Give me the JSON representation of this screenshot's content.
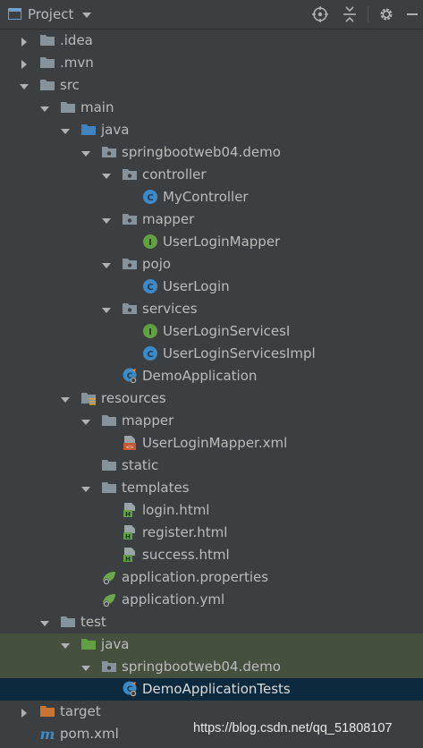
{
  "header": {
    "title": "Project"
  },
  "tree": [
    {
      "label": "target",
      "depth": 0,
      "arrow": "right",
      "icon": "folder-orange",
      "name": "tree-item-target",
      "top": 0
    },
    {
      "label": ".idea",
      "depth": 0,
      "arrow": "right",
      "icon": "folder"
    },
    {
      "label": ".mvn",
      "depth": 0,
      "arrow": "right",
      "icon": "folder"
    },
    {
      "label": "src",
      "depth": 0,
      "arrow": "down",
      "icon": "folder"
    },
    {
      "label": "main",
      "depth": 1,
      "arrow": "down",
      "icon": "folder"
    },
    {
      "label": "java",
      "depth": 2,
      "arrow": "down",
      "icon": "folder-blue"
    },
    {
      "label": "springbootweb04.demo",
      "depth": 3,
      "arrow": "down",
      "icon": "package"
    },
    {
      "label": "controller",
      "depth": 4,
      "arrow": "down",
      "icon": "package"
    },
    {
      "label": "MyController",
      "depth": 5,
      "arrow": "none",
      "icon": "class"
    },
    {
      "label": "mapper",
      "depth": 4,
      "arrow": "down",
      "icon": "package"
    },
    {
      "label": "UserLoginMapper",
      "depth": 5,
      "arrow": "none",
      "icon": "interface"
    },
    {
      "label": "pojo",
      "depth": 4,
      "arrow": "down",
      "icon": "package"
    },
    {
      "label": "UserLogin",
      "depth": 5,
      "arrow": "none",
      "icon": "class"
    },
    {
      "label": "services",
      "depth": 4,
      "arrow": "down",
      "icon": "package"
    },
    {
      "label": "UserLoginServicesI",
      "depth": 5,
      "arrow": "none",
      "icon": "interface"
    },
    {
      "label": "UserLoginServicesImpl",
      "depth": 5,
      "arrow": "none",
      "icon": "class"
    },
    {
      "label": "DemoApplication",
      "depth": 4,
      "arrow": "none",
      "icon": "spring-class"
    },
    {
      "label": "resources",
      "depth": 2,
      "arrow": "down",
      "icon": "folder-resources"
    },
    {
      "label": "mapper",
      "depth": 3,
      "arrow": "down",
      "icon": "folder"
    },
    {
      "label": "UserLoginMapper.xml",
      "depth": 4,
      "arrow": "none",
      "icon": "xml-file"
    },
    {
      "label": "static",
      "depth": 3,
      "arrow": "none",
      "icon": "folder"
    },
    {
      "label": "templates",
      "depth": 3,
      "arrow": "down",
      "icon": "folder"
    },
    {
      "label": "login.html",
      "depth": 4,
      "arrow": "none",
      "icon": "html-file"
    },
    {
      "label": "register.html",
      "depth": 4,
      "arrow": "none",
      "icon": "html-file"
    },
    {
      "label": "success.html",
      "depth": 4,
      "arrow": "none",
      "icon": "html-file"
    },
    {
      "label": "application.properties",
      "depth": 3,
      "arrow": "none",
      "icon": "spring-config"
    },
    {
      "label": "application.yml",
      "depth": 3,
      "arrow": "none",
      "icon": "spring-config"
    },
    {
      "label": "test",
      "depth": 1,
      "arrow": "down",
      "icon": "folder"
    },
    {
      "label": "java",
      "depth": 2,
      "arrow": "down",
      "icon": "folder-green",
      "state": "highlight"
    },
    {
      "label": "springbootweb04.demo",
      "depth": 3,
      "arrow": "down",
      "icon": "package",
      "state": "highlight"
    },
    {
      "label": "DemoApplicationTests",
      "depth": 4,
      "arrow": "none",
      "icon": "spring-class",
      "state": "selected"
    },
    {
      "label": "target",
      "depth": 0,
      "arrow": "right",
      "icon": "folder-orange"
    },
    {
      "label": "pom.xml",
      "depth": 0,
      "arrow": "none",
      "icon": "maven-file"
    }
  ],
  "watermark": "https://blog.csdn.net/qq_51808107",
  "colors": {
    "background": "#3c3f41",
    "selection": "#0d293e",
    "highlight": "#45503f",
    "text": "#bbbbbb"
  }
}
